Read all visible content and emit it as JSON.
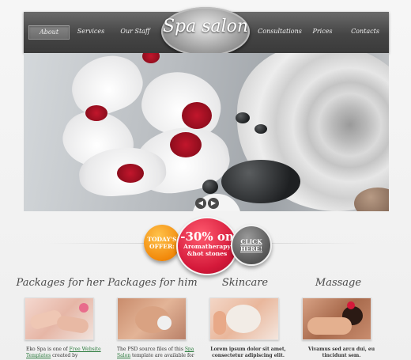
{
  "nav": {
    "items": [
      "About",
      "Services",
      "Our Staff",
      "Consultations",
      "Prices",
      "Contacts"
    ],
    "active_index": 0
  },
  "logo": {
    "text": "Spa salon"
  },
  "slider": {
    "prev_glyph": "◀",
    "next_glyph": "▶"
  },
  "offer": {
    "left_line1": "TODAY'S",
    "left_line2": "OFFER:",
    "center_big": "-30% on",
    "center_line2": "Aromatherapy",
    "center_line3": "&hot stones",
    "right_line1": "CLICK",
    "right_line2": "HERE!"
  },
  "columns": [
    {
      "title": "Packages for her",
      "text_prefix": "Eko Spa is one of ",
      "link": "Free Website Templates",
      "text_suffix": " created by"
    },
    {
      "title": "Packages for him",
      "text_prefix": "The PSD source files of this ",
      "link": "Spa Salon",
      "text_suffix": " template are available for"
    },
    {
      "title": "Skincare",
      "text_prefix": "Lorem ipsum dolor sit amet, consectetur adipiscing elit.",
      "link": "",
      "text_suffix": ""
    },
    {
      "title": "Massage",
      "text_prefix": "Vivamus sed arcu dui, eu tincidunt sem.",
      "link": "",
      "text_suffix": ""
    }
  ],
  "colors": {
    "accent_orange": "#f28a0c",
    "accent_red": "#d4193a",
    "header": "#454545",
    "link": "#2a7a3c"
  }
}
